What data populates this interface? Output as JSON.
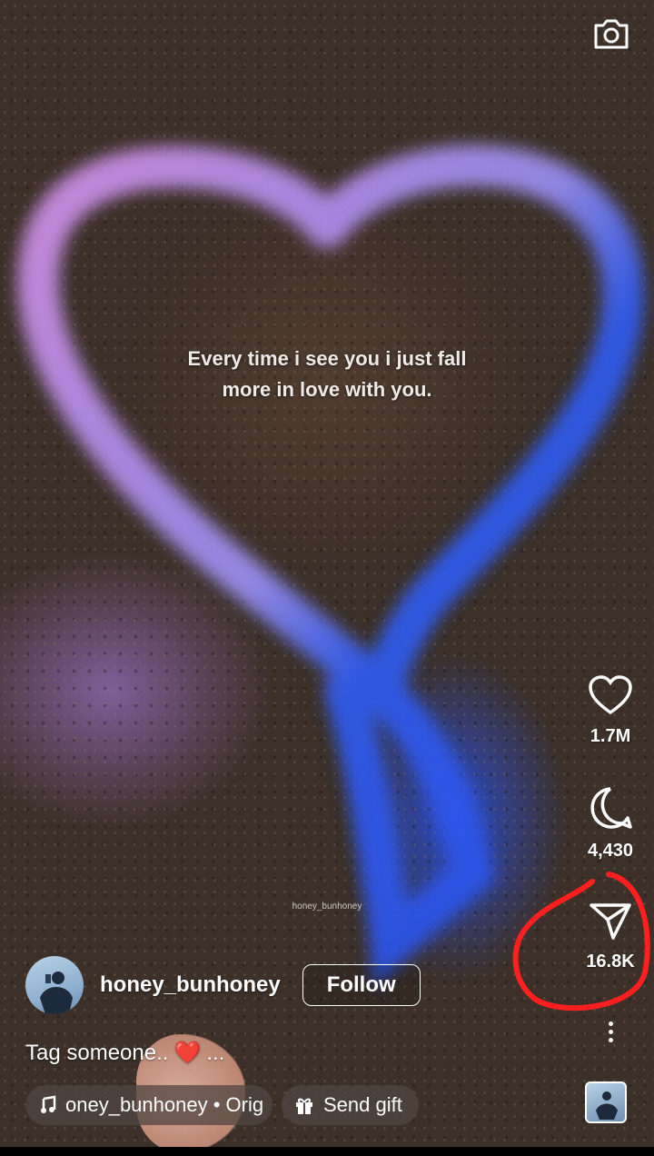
{
  "reel": {
    "overlay_text": "Every time i see you i just fall more in love with you.",
    "watermark": "honey_bunhoney"
  },
  "actions": {
    "likes": "1.7M",
    "comments": "4,430",
    "shares": "16.8K"
  },
  "author": {
    "username": "honey_bunhoney",
    "follow_label": "Follow"
  },
  "caption": {
    "text": "Tag someone..",
    "emoji": "❤️",
    "more": "..."
  },
  "audio": {
    "label": "oney_bunhoney • Orig"
  },
  "gift": {
    "label": "Send gift"
  },
  "colors": {
    "annotation_red": "#ff1f1f",
    "heart_pink": "#c48be0",
    "heart_blue": "#2f5cf0"
  },
  "icons": [
    "camera-icon",
    "heart-icon",
    "comment-icon",
    "share-icon",
    "more-icon",
    "music-note-icon",
    "gift-icon"
  ]
}
